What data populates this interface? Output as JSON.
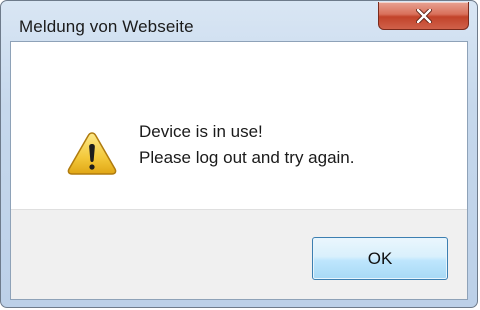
{
  "window": {
    "title": "Meldung von Webseite",
    "close_icon": "close-x-icon"
  },
  "dialog": {
    "icon": "warning-icon",
    "message_line1": "Device is in use!",
    "message_line2": "Please log out and try again."
  },
  "buttons": {
    "ok_label": "OK"
  },
  "colors": {
    "close_button": "#c8472f",
    "warning_fill": "#f3c83a",
    "ok_border": "#3c7fb1"
  }
}
